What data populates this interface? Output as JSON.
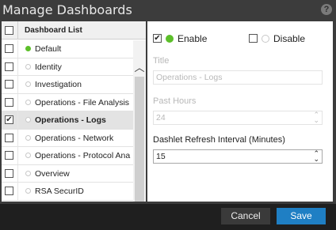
{
  "window": {
    "title": "Manage Dashboards",
    "help_glyph": "?"
  },
  "list": {
    "header_label": "Dashboard List",
    "items": [
      {
        "label": "Default",
        "checked": false,
        "active": true,
        "selected": false
      },
      {
        "label": "Identity",
        "checked": false,
        "active": false,
        "selected": false
      },
      {
        "label": "Investigation",
        "checked": false,
        "active": false,
        "selected": false
      },
      {
        "label": "Operations - File Analysis",
        "checked": false,
        "active": false,
        "selected": false
      },
      {
        "label": "Operations - Logs",
        "checked": true,
        "active": false,
        "selected": true
      },
      {
        "label": "Operations - Network",
        "checked": false,
        "active": false,
        "selected": false
      },
      {
        "label": "Operations - Protocol Ana",
        "checked": false,
        "active": false,
        "selected": false
      },
      {
        "label": "Overview",
        "checked": false,
        "active": false,
        "selected": false
      },
      {
        "label": "RSA SecurID",
        "checked": false,
        "active": false,
        "selected": false
      }
    ]
  },
  "details": {
    "enable_label": "Enable",
    "enable_checked": true,
    "disable_label": "Disable",
    "disable_checked": false,
    "title_label": "Title",
    "title_value": "Operations - Logs",
    "past_hours_label": "Past Hours",
    "past_hours_value": "24",
    "refresh_label": "Dashlet Refresh Interval (Minutes)",
    "refresh_value": "15"
  },
  "footer": {
    "cancel_label": "Cancel",
    "save_label": "Save"
  },
  "colors": {
    "accent": "#1f7fc4",
    "status_on": "#5cbf2a",
    "titlebar": "#3c3c3c"
  },
  "icons": {
    "check": "✔",
    "spinner": "⌃⌄",
    "scroll_up": "︿",
    "scroll_down": "﹀"
  }
}
